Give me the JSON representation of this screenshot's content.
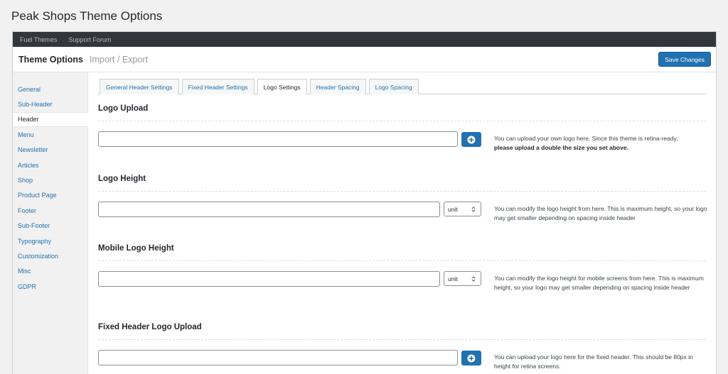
{
  "page_title": "Peak Shops Theme Options",
  "topbar": {
    "links": [
      "Fuel Themes",
      "Support Forum"
    ]
  },
  "header": {
    "title": "Theme Options",
    "import_export": "Import / Export",
    "save_label": "Save Changes",
    "accent_color": "#2271b1"
  },
  "sidebar": {
    "items": [
      {
        "label": "General"
      },
      {
        "label": "Sub-Header"
      },
      {
        "label": "Header",
        "active": true
      },
      {
        "label": "Menu"
      },
      {
        "label": "Newsletter"
      },
      {
        "label": "Articles"
      },
      {
        "label": "Shop"
      },
      {
        "label": "Product Page"
      },
      {
        "label": "Footer"
      },
      {
        "label": "Sub-Footer"
      },
      {
        "label": "Typography"
      },
      {
        "label": "Customization"
      },
      {
        "label": "Misc"
      },
      {
        "label": "GDPR"
      }
    ]
  },
  "tabs": [
    {
      "label": "General Header Settings"
    },
    {
      "label": "Fixed Header Settings"
    },
    {
      "label": "Logo Settings",
      "active": true
    },
    {
      "label": "Header Spacing"
    },
    {
      "label": "Logo Spacing"
    }
  ],
  "sections": {
    "logo_upload": {
      "title": "Logo Upload",
      "input_value": "",
      "desc": "You can upload your own logo here. Since this theme is retina-ready,",
      "desc_bold": "please upload a double the size you set above."
    },
    "logo_height": {
      "title": "Logo Height",
      "input_value": "",
      "unit": "unit",
      "desc": "You can modify the logo height from here. This is maximum height, so your logo may get smaller depending on spacing inside header"
    },
    "mobile_logo_height": {
      "title": "Mobile Logo Height",
      "input_value": "",
      "unit": "unit",
      "desc": "You can modify the logo height for mobile screens from here. This is maximum height, so your logo may get smaller depending on spacing inside header"
    },
    "fixed_logo_upload": {
      "title": "Fixed Header Logo Upload",
      "input_value": "",
      "desc": "You can upload your logo here for the fixed header. This should be 80px in height for retina screens."
    }
  }
}
